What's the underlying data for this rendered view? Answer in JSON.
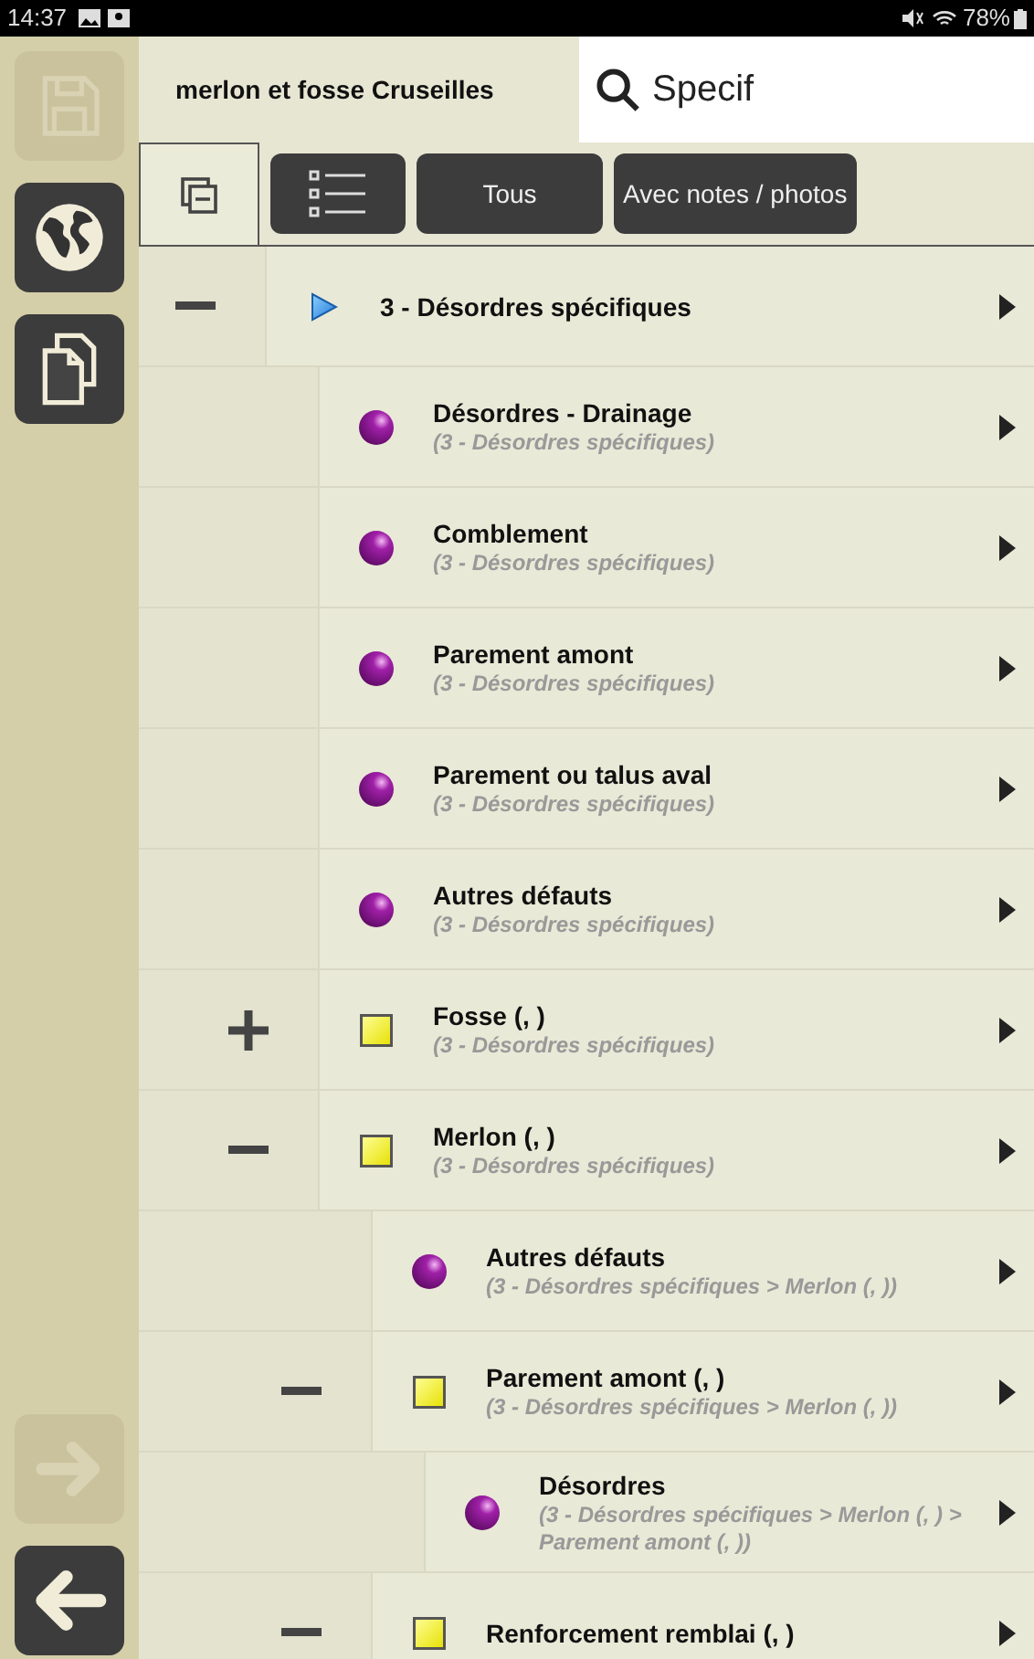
{
  "status_bar": {
    "time": "14:37",
    "battery": "78%"
  },
  "sidebar": {
    "buttons": [
      {
        "kind": "save",
        "disabled": true
      },
      {
        "kind": "globe",
        "disabled": false
      },
      {
        "kind": "copy",
        "disabled": false
      },
      {
        "kind": "forward",
        "disabled": true
      },
      {
        "kind": "back",
        "disabled": false
      }
    ]
  },
  "header": {
    "title": "merlon et fosse Cruseilles",
    "search": {
      "value": "Specif"
    }
  },
  "toolbar": {
    "buttons": [
      {
        "kind": "collapse"
      },
      {
        "kind": "list"
      },
      {
        "kind": "text",
        "label": "Tous"
      },
      {
        "kind": "text",
        "label": "Avec notes / photos"
      }
    ]
  },
  "tree": [
    {
      "kind": "group",
      "label": "3 - Désordres spécifiques",
      "expanded": true,
      "children": [
        {
          "kind": "leaf",
          "label": "Désordres - Drainage",
          "path": "(3 - Désordres spécifiques)"
        },
        {
          "kind": "leaf",
          "label": "Comblement",
          "path": "(3 - Désordres spécifiques)"
        },
        {
          "kind": "leaf",
          "label": "Parement amont",
          "path": "(3 - Désordres spécifiques)"
        },
        {
          "kind": "leaf",
          "label": "Parement ou talus aval",
          "path": "(3 - Désordres spécifiques)"
        },
        {
          "kind": "leaf",
          "label": "Autres défauts",
          "path": "(3 - Désordres spécifiques)"
        },
        {
          "kind": "folder",
          "label": "Fosse (, )",
          "path": "(3 - Désordres spécifiques)",
          "expanded": false
        },
        {
          "kind": "folder",
          "label": "Merlon (, )",
          "path": "(3 - Désordres spécifiques)",
          "expanded": true,
          "children": [
            {
              "kind": "leaf",
              "label": "Autres défauts",
              "path": "(3 - Désordres spécifiques > Merlon (, ))"
            },
            {
              "kind": "folder",
              "label": "Parement amont (, )",
              "path": "(3 - Désordres spécifiques > Merlon (, ))",
              "expanded": true,
              "children": [
                {
                  "kind": "leaf",
                  "label": "Désordres",
                  "path": "(3 - Désordres spécifiques > Merlon (, ) > Parement amont (, ))"
                }
              ]
            },
            {
              "kind": "folder",
              "label": "Renforcement remblai (, )",
              "expanded": true
            }
          ]
        }
      ]
    }
  ]
}
